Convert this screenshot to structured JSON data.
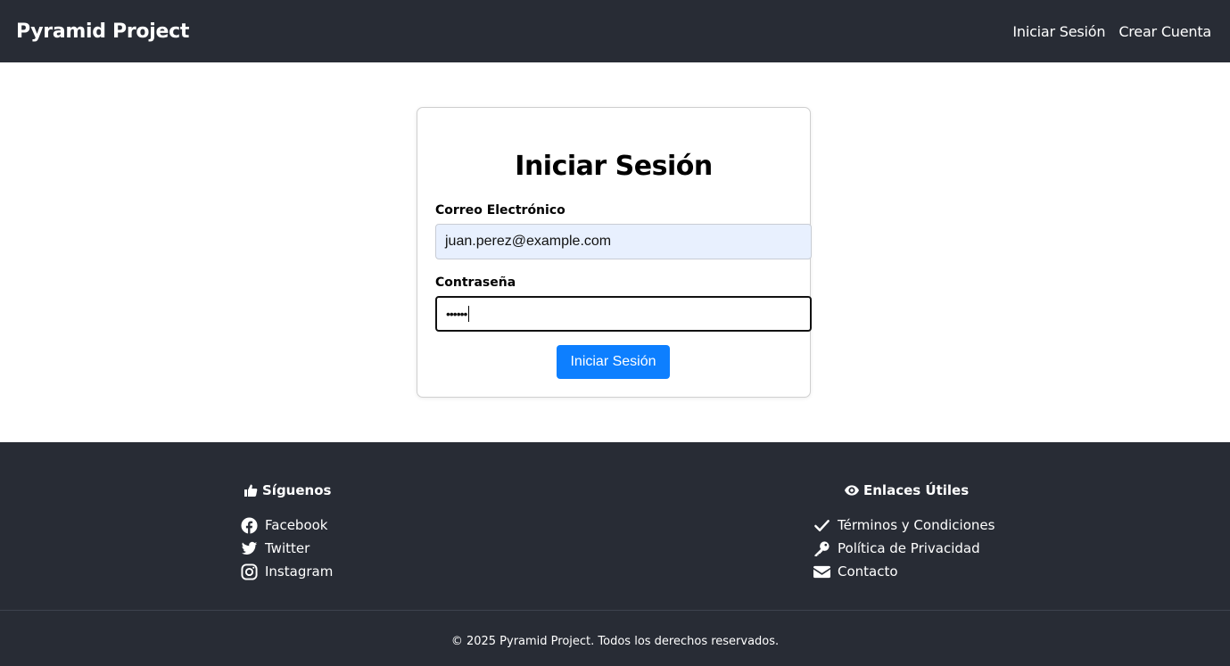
{
  "navbar": {
    "brand": "Pyramid Project",
    "links": [
      {
        "label": "Iniciar Sesión"
      },
      {
        "label": "Crear Cuenta"
      }
    ]
  },
  "login": {
    "title": "Iniciar Sesión",
    "email_label": "Correo Electrónico",
    "email_value": "juan.perez@example.com",
    "password_label": "Contraseña",
    "password_value": "••••••",
    "submit_label": "Iniciar Sesión"
  },
  "footer": {
    "social": {
      "title": "Síguenos",
      "icon": "thumbs-up-icon",
      "items": [
        {
          "label": "Facebook",
          "icon": "facebook-icon"
        },
        {
          "label": "Twitter",
          "icon": "twitter-icon"
        },
        {
          "label": "Instagram",
          "icon": "instagram-icon"
        }
      ]
    },
    "links": {
      "title": "Enlaces Útiles",
      "icon": "eye-icon",
      "items": [
        {
          "label": "Términos y Condiciones",
          "icon": "check-icon"
        },
        {
          "label": "Política de Privacidad",
          "icon": "key-icon"
        },
        {
          "label": "Contacto",
          "icon": "envelope-icon"
        }
      ]
    },
    "copyright": "© 2025 Pyramid Project. Todos los derechos reservados."
  },
  "colors": {
    "dark_bg": "#282c35",
    "primary": "#0d7fff",
    "autofill_bg": "#e8f0fe"
  }
}
